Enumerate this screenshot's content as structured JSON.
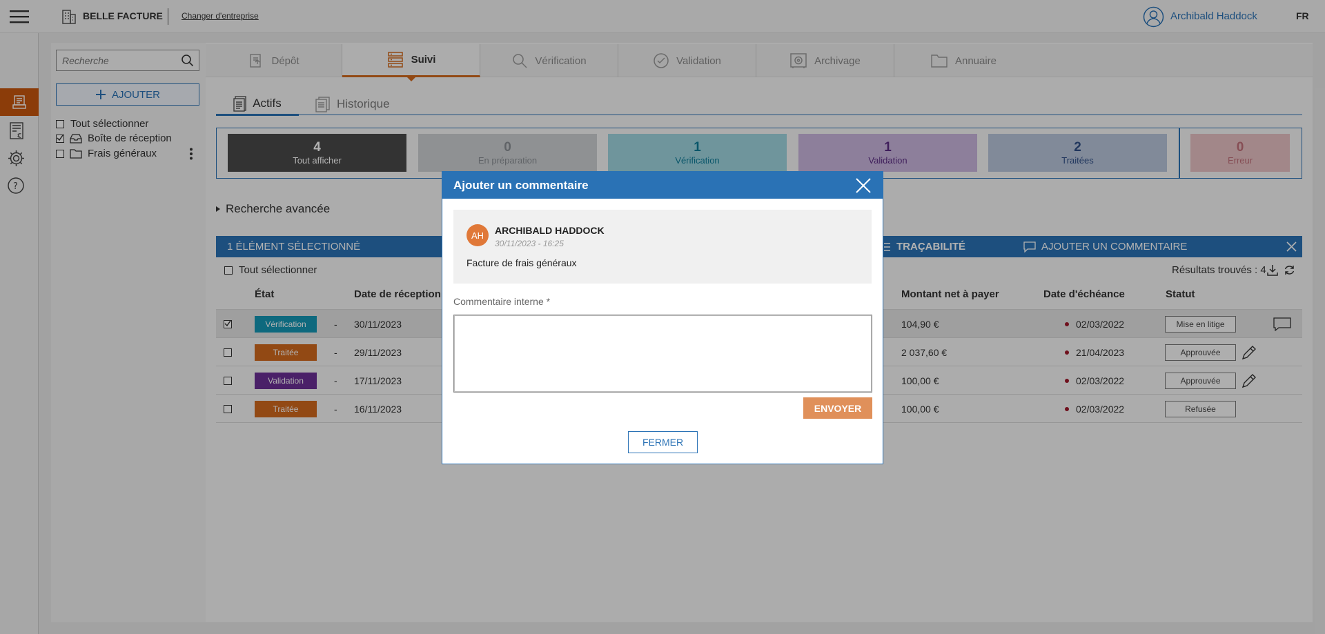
{
  "header": {
    "brand": "BELLE FACTURE",
    "change_company": "Changer d'entreprise",
    "user_name": "Archibald Haddock",
    "language": "FR"
  },
  "sidebar_icons": [
    "invoice-icon",
    "invoice-euro-icon",
    "gear-icon",
    "help-icon"
  ],
  "filters": {
    "search_placeholder": "Recherche",
    "add_label": "AJOUTER",
    "select_all": "Tout sélectionner",
    "folders": [
      {
        "label": "Boîte de réception",
        "checked": true
      },
      {
        "label": "Frais généraux",
        "checked": false
      }
    ]
  },
  "main_tabs": [
    {
      "label": "Dépôt"
    },
    {
      "label": "Suivi",
      "active": true
    },
    {
      "label": "Vérification"
    },
    {
      "label": "Validation"
    },
    {
      "label": "Archivage"
    },
    {
      "label": "Annuaire"
    }
  ],
  "sub_tabs": [
    {
      "label": "Actifs",
      "active": true
    },
    {
      "label": "Historique"
    }
  ],
  "status_cards": [
    {
      "count": "4",
      "label": "Tout afficher",
      "bg": "#4a4a4a",
      "fg": "#ffffff"
    },
    {
      "count": "0",
      "label": "En préparation",
      "bg": "#cdd0d3",
      "fg": "#8a8f94"
    },
    {
      "count": "1",
      "label": "Vérification",
      "bg": "#9fd6e0",
      "fg": "#0e7c99"
    },
    {
      "count": "1",
      "label": "Validation",
      "bg": "#cab7de",
      "fg": "#5b2c83"
    },
    {
      "count": "2",
      "label": "Traitées",
      "bg": "#b9c6dc",
      "fg": "#2e4e86"
    },
    {
      "count": "0",
      "label": "Erreur",
      "bg": "#e8c2c4",
      "fg": "#c0707a"
    }
  ],
  "advanced_search": "Recherche avancée",
  "selection_bar": {
    "count_label": "1 ÉLÉMENT SÉLECTIONNÉ",
    "traceability": "TRAÇABILITÉ",
    "add_comment": "AJOUTER UN COMMENTAIRE"
  },
  "table": {
    "select_all": "Tout sélectionner",
    "results": "Résultats trouvés : 4",
    "columns": {
      "state": "État",
      "received": "Date de réception",
      "amount": "Montant net à payer",
      "due": "Date d'échéance",
      "status": "Statut"
    },
    "rows": [
      {
        "checked": true,
        "state": "Vérification",
        "state_color": "#1597b5",
        "dash": "-",
        "received": "30/11/2023",
        "amount": "104,90 €",
        "due": "02/03/2022",
        "status": "Mise en litige",
        "action": "comment-icon"
      },
      {
        "checked": false,
        "state": "Traitée",
        "state_color": "#d2691e",
        "dash": "-",
        "received": "29/11/2023",
        "amount": "2 037,60 €",
        "due": "21/04/2023",
        "status": "Approuvée",
        "action": "pencil-icon"
      },
      {
        "checked": false,
        "state": "Validation",
        "state_color": "#6a2f96",
        "dash": "-",
        "received": "17/11/2023",
        "amount": "100,00 €",
        "due": "02/03/2022",
        "status": "Approuvée",
        "action": "pencil-icon"
      },
      {
        "checked": false,
        "state": "Traitée",
        "state_color": "#d2691e",
        "dash": "-",
        "received": "16/11/2023",
        "amount": "100,00 €",
        "due": "02/03/2022",
        "status": "Refusée",
        "action": ""
      }
    ]
  },
  "modal": {
    "title": "Ajouter un commentaire",
    "comment": {
      "initials": "AH",
      "author": "ARCHIBALD HADDOCK",
      "datetime": "30/11/2023 - 16:25",
      "text": "Facture de frais généraux"
    },
    "field_label": "Commentaire interne *",
    "field_value": "",
    "send": "ENVOYER",
    "close": "FERMER"
  },
  "colors": {
    "accent": "#d2691e",
    "blue": "#2a72b5",
    "send": "#e0905a"
  }
}
